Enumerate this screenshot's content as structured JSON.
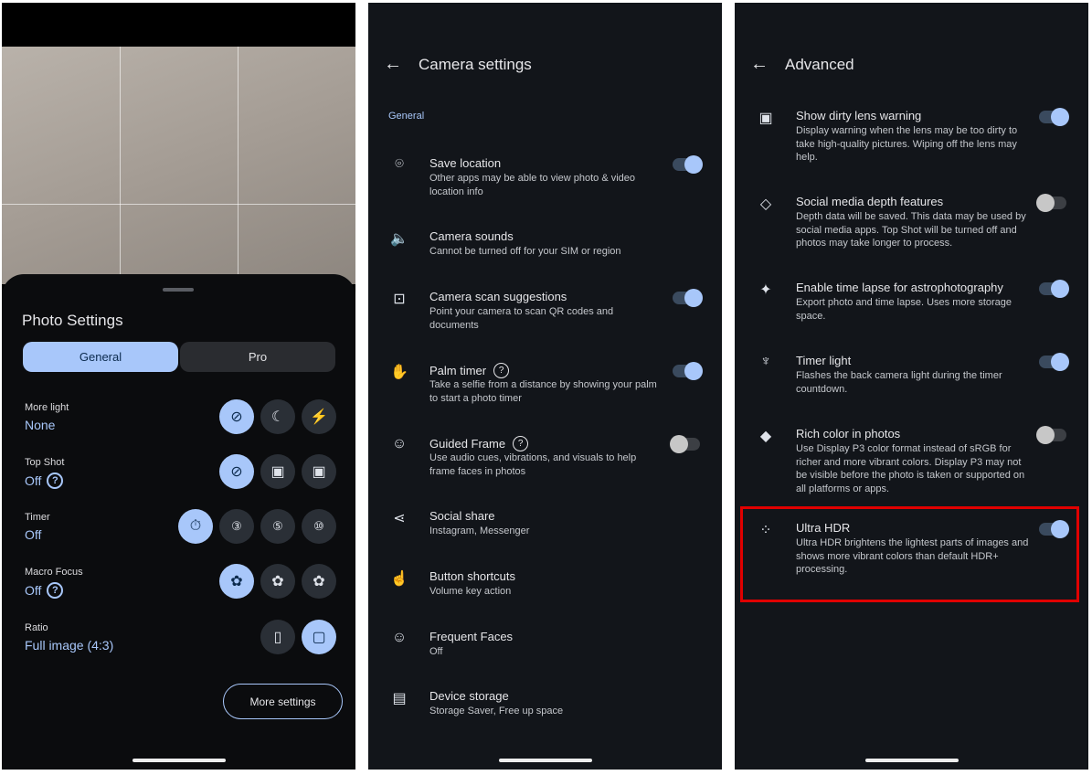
{
  "photo_settings": {
    "title": "Photo Settings",
    "tabs": [
      "General",
      "Pro"
    ],
    "active_tab": "General",
    "rows": [
      {
        "label": "More light",
        "value": "None",
        "help": false
      },
      {
        "label": "Top Shot",
        "value": "Off",
        "help": true
      },
      {
        "label": "Timer",
        "value": "Off",
        "help": false
      },
      {
        "label": "Macro Focus",
        "value": "Off",
        "help": true
      },
      {
        "label": "Ratio",
        "value": "Full image (4:3)",
        "help": false
      }
    ],
    "help_glyph": "?",
    "more_settings": "More settings"
  },
  "camera_settings": {
    "title": "Camera settings",
    "category": "General",
    "items": [
      {
        "title": "Save location",
        "subtitle": "Other apps may be able to view photo & video location info",
        "icon": "location-pin",
        "toggle": true
      },
      {
        "title": "Camera sounds",
        "subtitle": "Cannot be turned off for your SIM or region",
        "icon": "speaker"
      },
      {
        "title": "Camera scan suggestions",
        "subtitle": "Point your camera to scan QR codes and documents",
        "icon": "scan",
        "toggle": true
      },
      {
        "title": "Palm timer",
        "subtitle": "Take a selfie from a distance by showing your palm to start a photo timer",
        "icon": "palm",
        "toggle": true,
        "help": true
      },
      {
        "title": "Guided Frame",
        "subtitle": "Use audio cues, vibrations, and visuals to help frame faces in photos",
        "icon": "face-frame",
        "toggle": false,
        "help": true
      },
      {
        "title": "Social share",
        "subtitle": "Instagram, Messenger",
        "icon": "share"
      },
      {
        "title": "Button shortcuts",
        "subtitle": "Volume key action",
        "icon": "touch"
      },
      {
        "title": "Frequent Faces",
        "subtitle": "Off",
        "icon": "face"
      },
      {
        "title": "Device storage",
        "subtitle": "Storage Saver, Free up space",
        "icon": "sd-card"
      }
    ]
  },
  "advanced": {
    "title": "Advanced",
    "items": [
      {
        "title": "Show dirty lens warning",
        "subtitle": "Display warning when the lens may be too dirty to take high-quality pictures. Wiping off the lens may help.",
        "icon": "lens-warning",
        "toggle": true
      },
      {
        "title": "Social media depth features",
        "subtitle": "Depth data will be saved. This data may be used by social media apps. Top Shot will be turned off and photos may take longer to process.",
        "icon": "layers",
        "toggle": false
      },
      {
        "title": "Enable time lapse for astrophotography",
        "subtitle": "Export photo and time lapse. Uses more storage space.",
        "icon": "sparkle",
        "toggle": true
      },
      {
        "title": "Timer light",
        "subtitle": "Flashes the back camera light during the timer countdown.",
        "icon": "flashlight",
        "toggle": true
      },
      {
        "title": "Rich color in photos",
        "subtitle": "Use Display P3 color format instead of sRGB for richer and more vibrant colors. Display P3 may not be visible before the photo is taken or supported on all platforms or apps.",
        "icon": "paint-bucket",
        "toggle": false
      },
      {
        "title": "Ultra HDR",
        "subtitle": "Ultra HDR brightens the lightest parts of images and shows more vibrant colors than default HDR+ processing.",
        "icon": "hdr-sunrise",
        "toggle": true,
        "highlighted": true
      }
    ]
  },
  "colors": {
    "accent": "#a8c7fa",
    "background": "#12151a",
    "highlight": "#e00000"
  }
}
